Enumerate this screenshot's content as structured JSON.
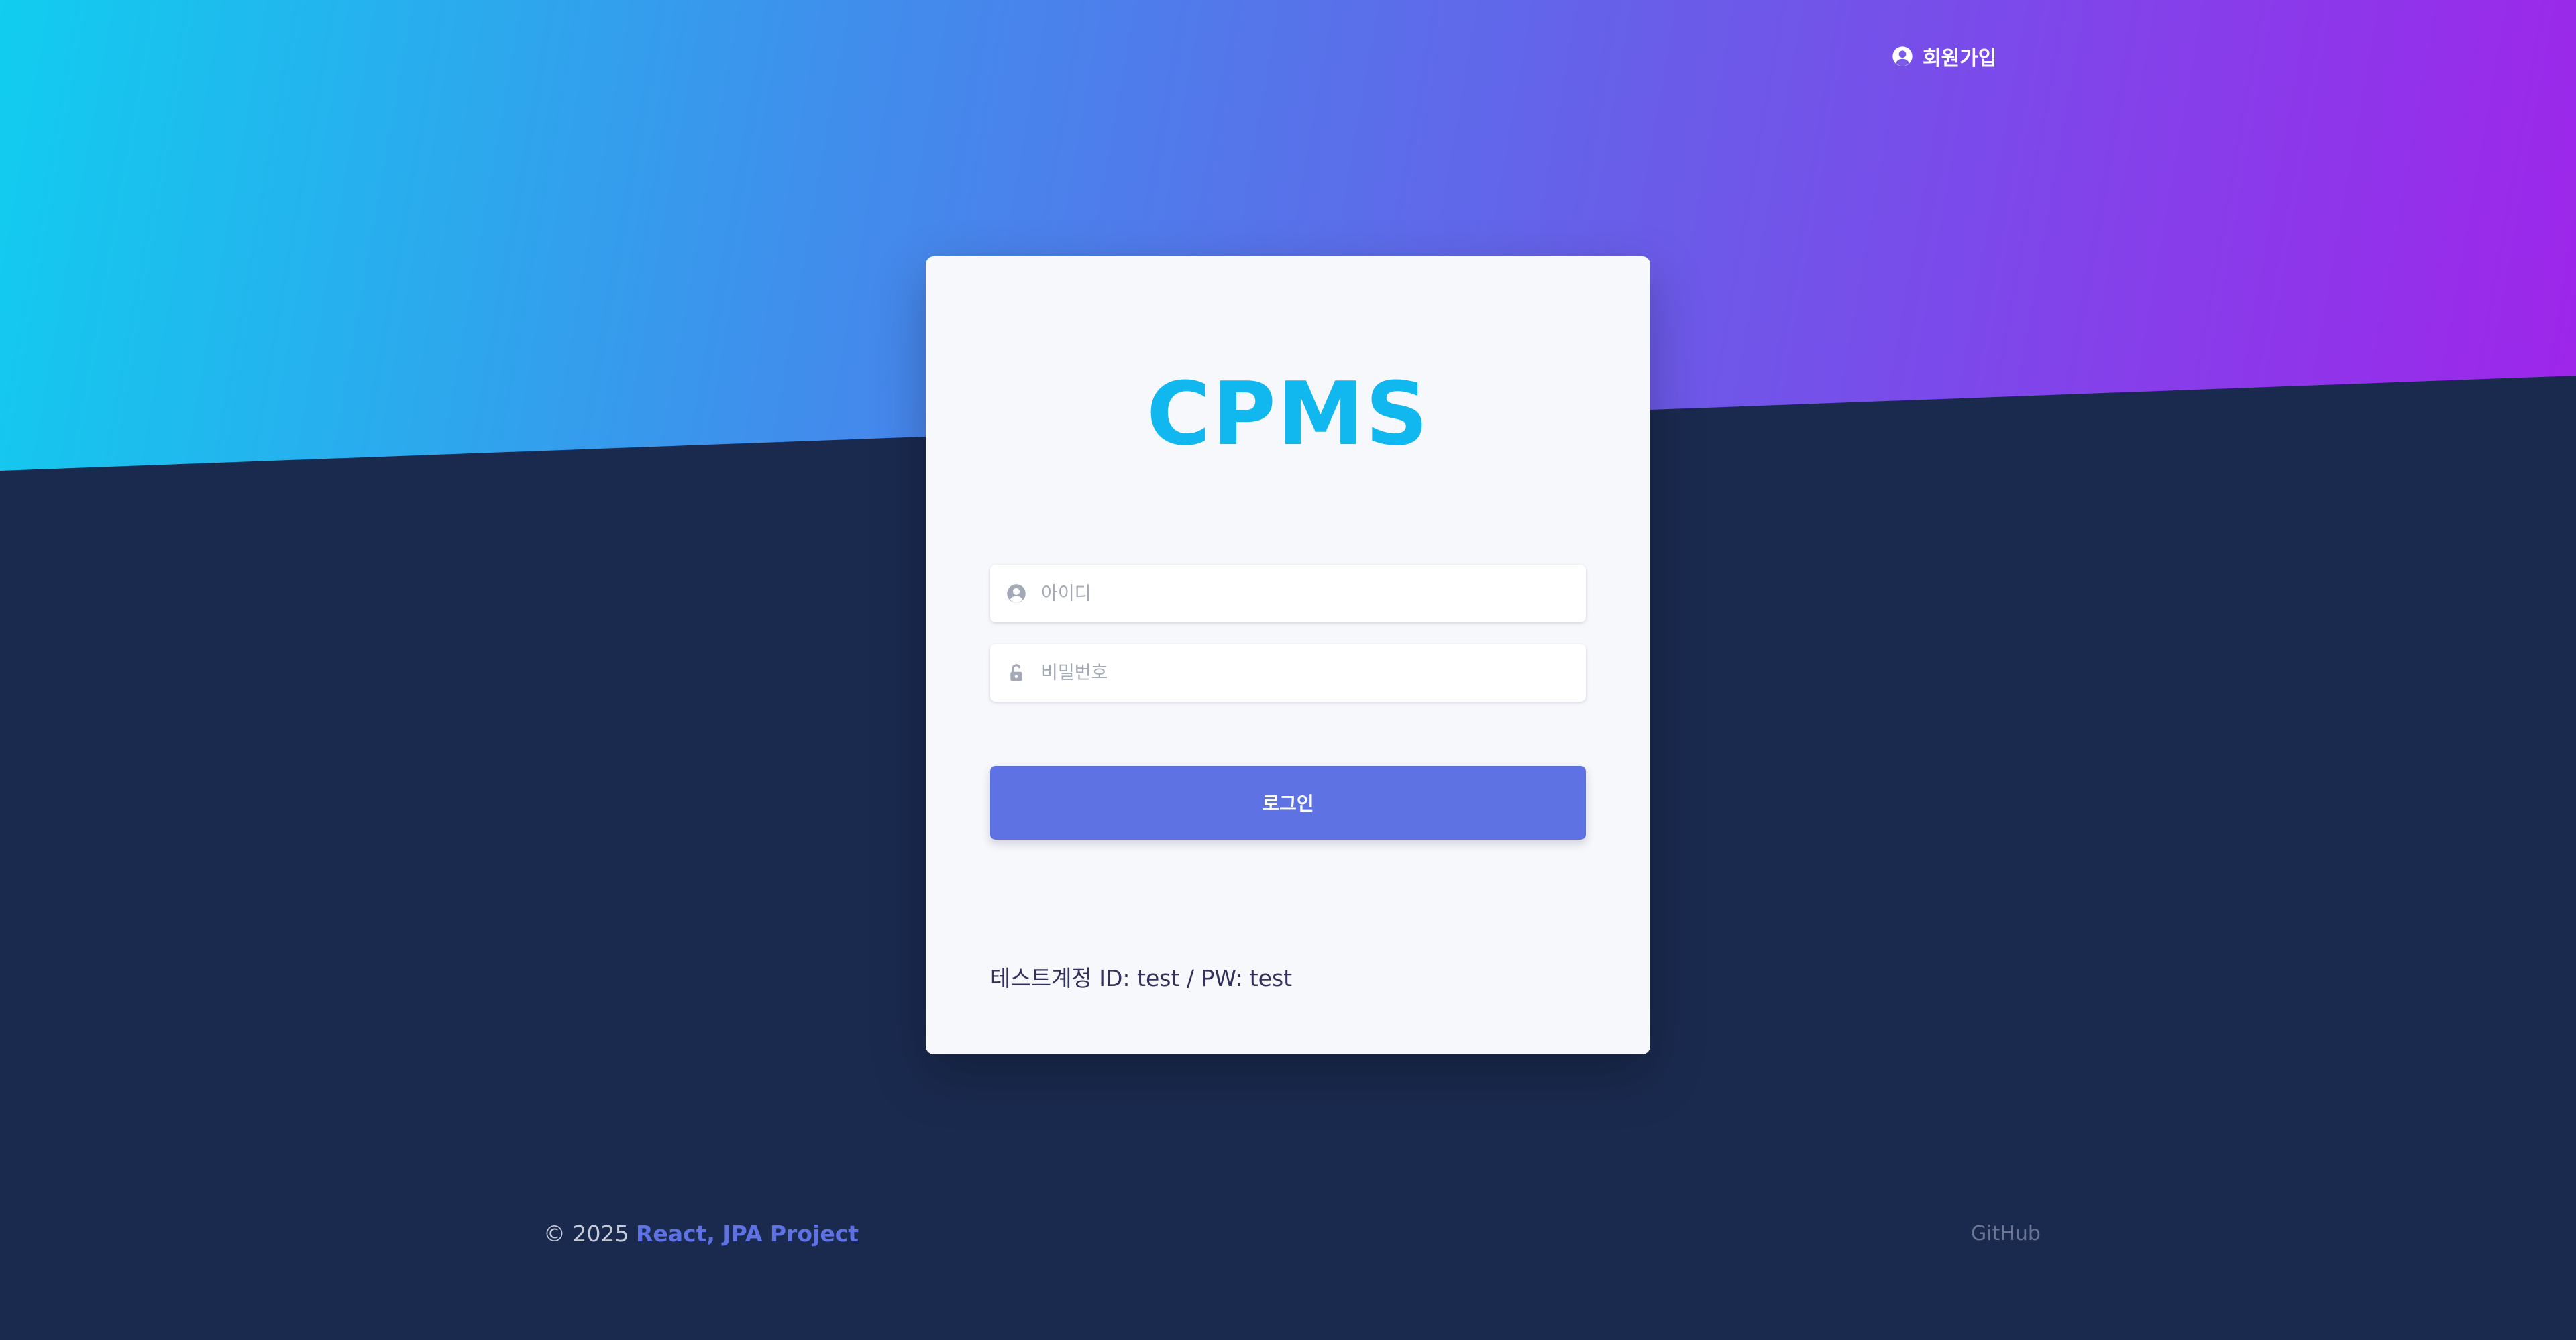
{
  "nav": {
    "signup_label": "회원가입",
    "signup_icon": "user-circle-icon"
  },
  "login_card": {
    "title": "CPMS",
    "username_placeholder": "아이디",
    "username_icon": "user-circle-icon",
    "password_placeholder": "비밀번호",
    "password_icon": "unlock-icon",
    "login_button_label": "로그인",
    "test_account_text": "테스트계정 ID: test / PW: test"
  },
  "footer": {
    "copyright": "© 2025",
    "project_name": "React, JPA Project",
    "github_label": "GitHub"
  },
  "colors": {
    "gradient_start": "#11cdef",
    "gradient_end": "#a71ceb",
    "background_dark": "#1a2a4f",
    "brand_primary": "#5e72e4",
    "logo_color": "#11b7ef"
  }
}
